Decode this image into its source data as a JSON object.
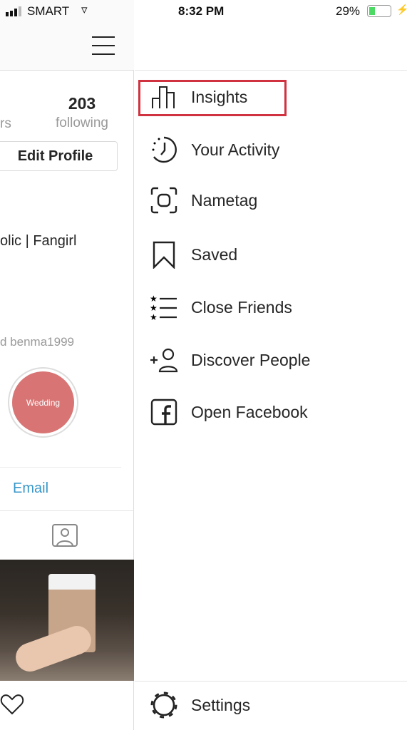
{
  "status": {
    "carrier": "SMART",
    "time": "8:32 PM",
    "battery": "29%",
    "battery_level": 0.29
  },
  "profile": {
    "following_count": "203",
    "following_label": "following",
    "followers_label_partial": "rs",
    "edit_profile": "Edit Profile",
    "bio_partial": "olic | Fangirl",
    "followed_by_partial": "d benma1999",
    "highlight": "Wedding",
    "email": "Email"
  },
  "menu": {
    "items": [
      {
        "label": "Insights",
        "icon": "bar-chart-icon"
      },
      {
        "label": "Your Activity",
        "icon": "activity-clock-icon"
      },
      {
        "label": "Nametag",
        "icon": "nametag-icon"
      },
      {
        "label": "Saved",
        "icon": "bookmark-icon"
      },
      {
        "label": "Close Friends",
        "icon": "close-friends-list-icon"
      },
      {
        "label": "Discover People",
        "icon": "add-person-icon"
      },
      {
        "label": "Open Facebook",
        "icon": "facebook-icon"
      }
    ],
    "settings": "Settings",
    "highlight_color": "#d0323f"
  }
}
